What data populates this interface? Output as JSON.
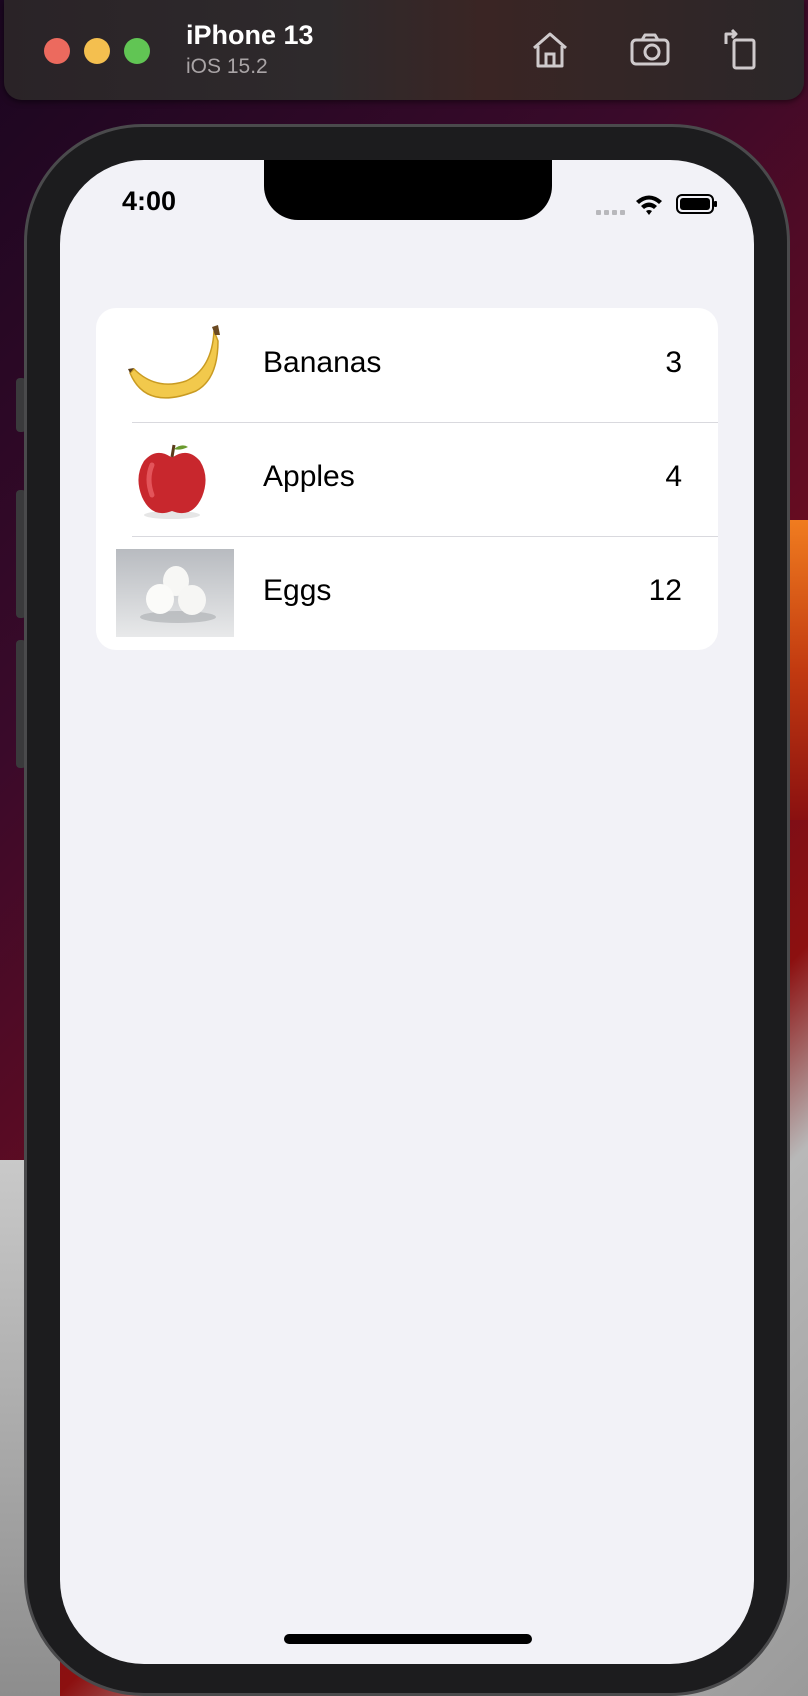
{
  "simulator": {
    "device_name": "iPhone 13",
    "os_version": "iOS 15.2",
    "buttons": [
      {
        "icon": "home-icon"
      },
      {
        "icon": "camera-icon"
      },
      {
        "icon": "rotate-icon"
      }
    ]
  },
  "status_bar": {
    "time": "4:00"
  },
  "list": {
    "items": [
      {
        "name": "Bananas",
        "count": "3",
        "image": "banana-image"
      },
      {
        "name": "Apples",
        "count": "4",
        "image": "apple-image"
      },
      {
        "name": "Eggs",
        "count": "12",
        "image": "eggs-image"
      }
    ]
  },
  "colors": {
    "screen_background": "#f2f2f7",
    "list_background": "#ffffff",
    "separator": "#d9d9de"
  }
}
